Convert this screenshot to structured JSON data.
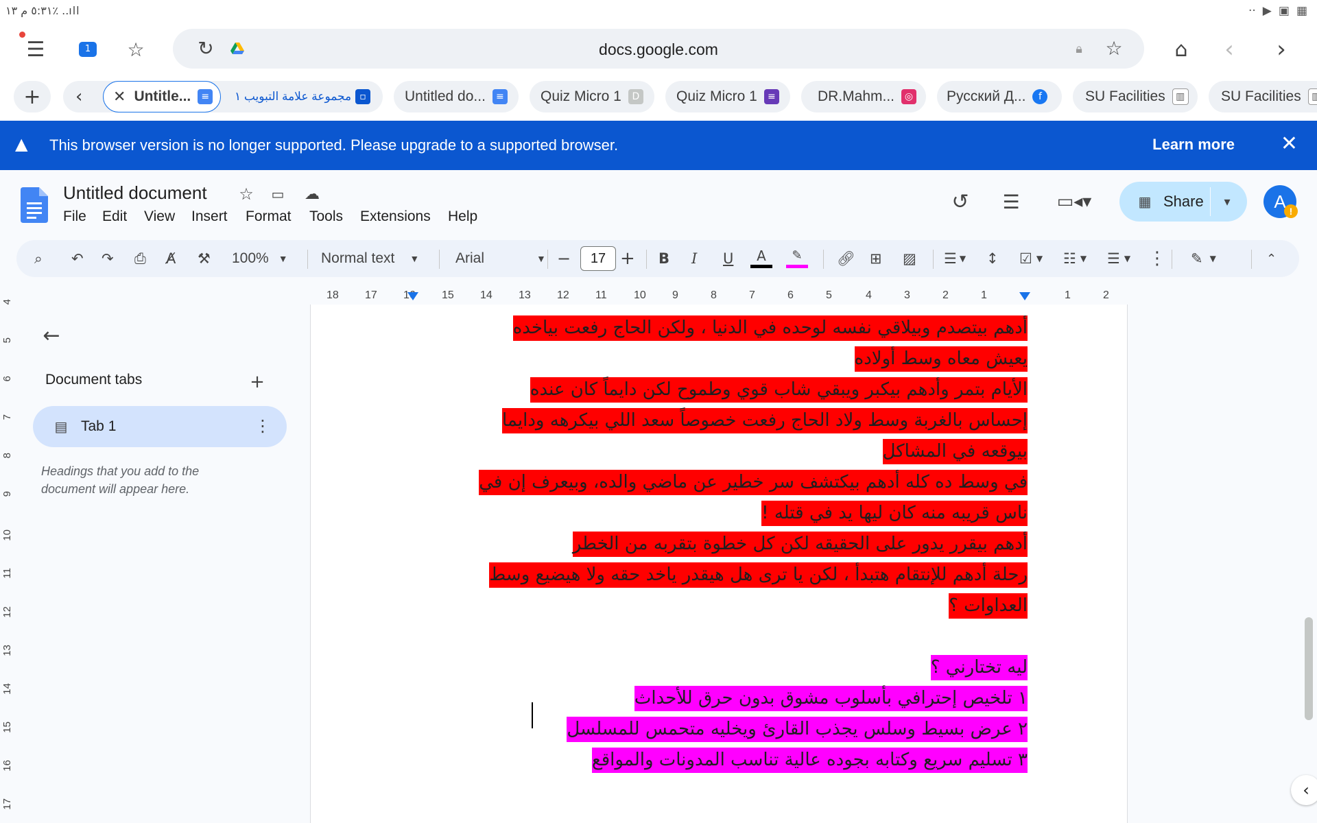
{
  "status_bar": {
    "time_battery": "٥:٣١ م  ١٣٪  ..ıll"
  },
  "browser": {
    "url": "docs.google.com",
    "tabs": [
      {
        "label": "Untitle...",
        "active": true
      },
      {
        "label": "مجموعة علامة التبويب ١"
      },
      {
        "label": "Untitled do..."
      },
      {
        "label": "Quiz Micro 1"
      },
      {
        "label": "Quiz Micro 1"
      },
      {
        "label": "DR.Mahm..."
      },
      {
        "label": "Русский Д..."
      },
      {
        "label": "SU Facilities"
      },
      {
        "label": "SU Facilities"
      }
    ]
  },
  "banner": {
    "message": "This browser version is no longer supported. Please upgrade to a supported browser.",
    "learn_more": "Learn more"
  },
  "docs": {
    "title": "Untitled document",
    "menu": [
      "File",
      "Edit",
      "View",
      "Insert",
      "Format",
      "Tools",
      "Extensions",
      "Help"
    ],
    "share_label": "Share",
    "avatar_letter": "A"
  },
  "toolbar": {
    "zoom": "100%",
    "style": "Normal text",
    "font": "Arial",
    "font_size": "17"
  },
  "ruler": {
    "h_ticks": [
      "18",
      "17",
      "16",
      "15",
      "14",
      "13",
      "12",
      "11",
      "10",
      "9",
      "8",
      "7",
      "6",
      "5",
      "4",
      "3",
      "2",
      "1",
      "1",
      "2"
    ],
    "v_ticks": [
      "4",
      "5",
      "6",
      "7",
      "8",
      "9",
      "10",
      "11",
      "12",
      "13",
      "14",
      "15",
      "16",
      "17"
    ]
  },
  "outline": {
    "heading": "Document tabs",
    "tab_name": "Tab 1",
    "hint": "Headings that you add to the document will appear here."
  },
  "document": {
    "lines": [
      {
        "text": "أدهم بيتصدم وبيلاقي نفسه لوحده في الدنيا ، ولكن الحاج رفعت بياخده",
        "hl": "red"
      },
      {
        "text": "يعيش معاه وسط أولاده",
        "hl": "red"
      },
      {
        "text": "الأيام بتمر وأدهم بيكبر ويبقي شاب قوي وطموح لكن دايماً كان عنده",
        "hl": "red"
      },
      {
        "text": "إحساس بالغربة وسط ولاد الحاج رفعت خصوصاً سعد اللي بيكرهه ودايما",
        "hl": "red"
      },
      {
        "text": "بيوقعه في المشاكل",
        "hl": "red"
      },
      {
        "text": "في وسط ده كله أدهم بيكتشف سر خطير عن ماضي والده، وبيعرف إن في",
        "hl": "red"
      },
      {
        "text": "ناس قريبه منه كان ليها يد في قتله !",
        "hl": "red"
      },
      {
        "text": "أدهم بيقرر يدور على الحقيقه لكن كل خطوة بتقربه من الخطر",
        "hl": "red"
      },
      {
        "text": "رحلة أدهم للإنتقام هتبدأ ، لكن يا ترى هل هيقدر ياخد حقه ولا هيضيع وسط",
        "hl": "red"
      },
      {
        "text": "العداوات ؟",
        "hl": "red"
      },
      {
        "text": "",
        "hl": "none"
      },
      {
        "text": "ليه تختارني ؟",
        "hl": "magenta"
      },
      {
        "text": "١ تلخيص إحترافي بأسلوب مشوق بدون حرق للأحداث",
        "hl": "magenta"
      },
      {
        "text": "٢ عرض بسيط وسلس يجذب القارئ ويخليه متحمس للمسلسل",
        "hl": "magenta"
      },
      {
        "text": "٣ تسليم سريع وكتابه بجوده عالية تناسب المدونات والمواقع",
        "hl": "magenta"
      }
    ]
  },
  "colors": {
    "banner": "#0b57d0",
    "share": "#c2e7ff",
    "highlight_red": "#ff0000",
    "highlight_magenta": "#ff00ff"
  }
}
